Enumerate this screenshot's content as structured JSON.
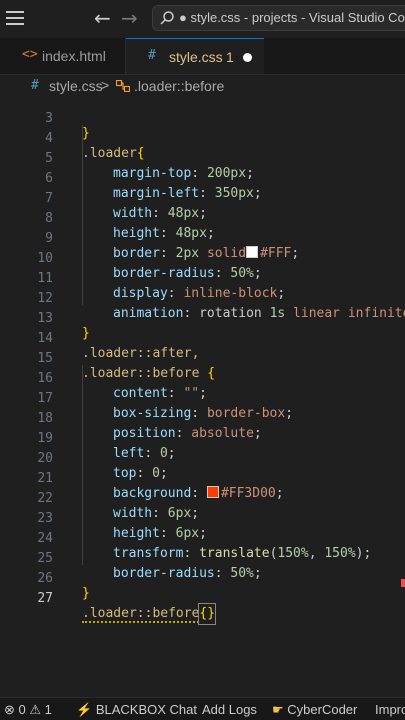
{
  "titlebar": {
    "search_text": "● style.css - projects - Visual Studio Code"
  },
  "tabs": [
    {
      "icon": "<>",
      "label": "index.html",
      "active": false
    },
    {
      "icon": "#",
      "label": "style.css",
      "problems": "1",
      "modified": true,
      "active": true
    }
  ],
  "breadcrumb": {
    "file": "style.css",
    "separator": ">",
    "symbol": ".loader::before"
  },
  "editor": {
    "line_numbers": [
      "3",
      "4",
      "5",
      "6",
      "7",
      "8",
      "9",
      "10",
      "11",
      "12",
      "13",
      "14",
      "15",
      "16",
      "17",
      "18",
      "19",
      "20",
      "21",
      "22",
      "23",
      "24",
      "25",
      "26",
      "27"
    ],
    "active_line": "27",
    "code": {
      "l3": "}",
      "l4_sel": ".loader",
      "l4_brace": "{",
      "l5_prop": "margin-top",
      "l5_val": "200px",
      "l6_prop": "margin-left",
      "l6_val": "350px",
      "l7_prop": "width",
      "l7_val": "48px",
      "l8_prop": "height",
      "l8_val": "48px",
      "l9_prop": "border",
      "l9_num": "2px",
      "l9_kw": "solid",
      "l9_color": "#FFF",
      "l10_prop": "border-radius",
      "l10_val": "50%",
      "l11_prop": "display",
      "l11_val": "inline-block",
      "l12_prop": "animation",
      "l12_name": "rotation",
      "l12_dur": "1s",
      "l12_rest": "linear infinite",
      "l13": "}",
      "l14_sel": ".loader::after,",
      "l15_sel": ".loader::before",
      "l15_brace": "{",
      "l16_prop": "content",
      "l16_val": "\"\"",
      "l17_prop": "box-sizing",
      "l17_val": "border-box",
      "l18_prop": "position",
      "l18_val": "absolute",
      "l19_prop": "left",
      "l19_val": "0",
      "l20_prop": "top",
      "l20_val": "0",
      "l21_prop": "background",
      "l21_color": "#FF3D00",
      "l22_prop": "width",
      "l22_val": "6px",
      "l23_prop": "height",
      "l23_val": "6px",
      "l24_prop": "transform",
      "l24_fn": "translate",
      "l24_a": "150%",
      "l24_b": "150%",
      "l25_prop": "border-radius",
      "l25_val": "50%",
      "l26": "}",
      "l27_sel": ".loader::before",
      "l27_braces": "{}"
    }
  },
  "statusbar": {
    "errors": "0",
    "warnings": "1",
    "blackbox": "BLACKBOX Chat",
    "add_logs": "Add Logs",
    "cybercoder": "CyberCoder",
    "improve": "Improve"
  },
  "colors": {
    "accent": "#0078d4",
    "swatch_white": "#FFFFFF",
    "swatch_orange": "#FF3D00"
  }
}
